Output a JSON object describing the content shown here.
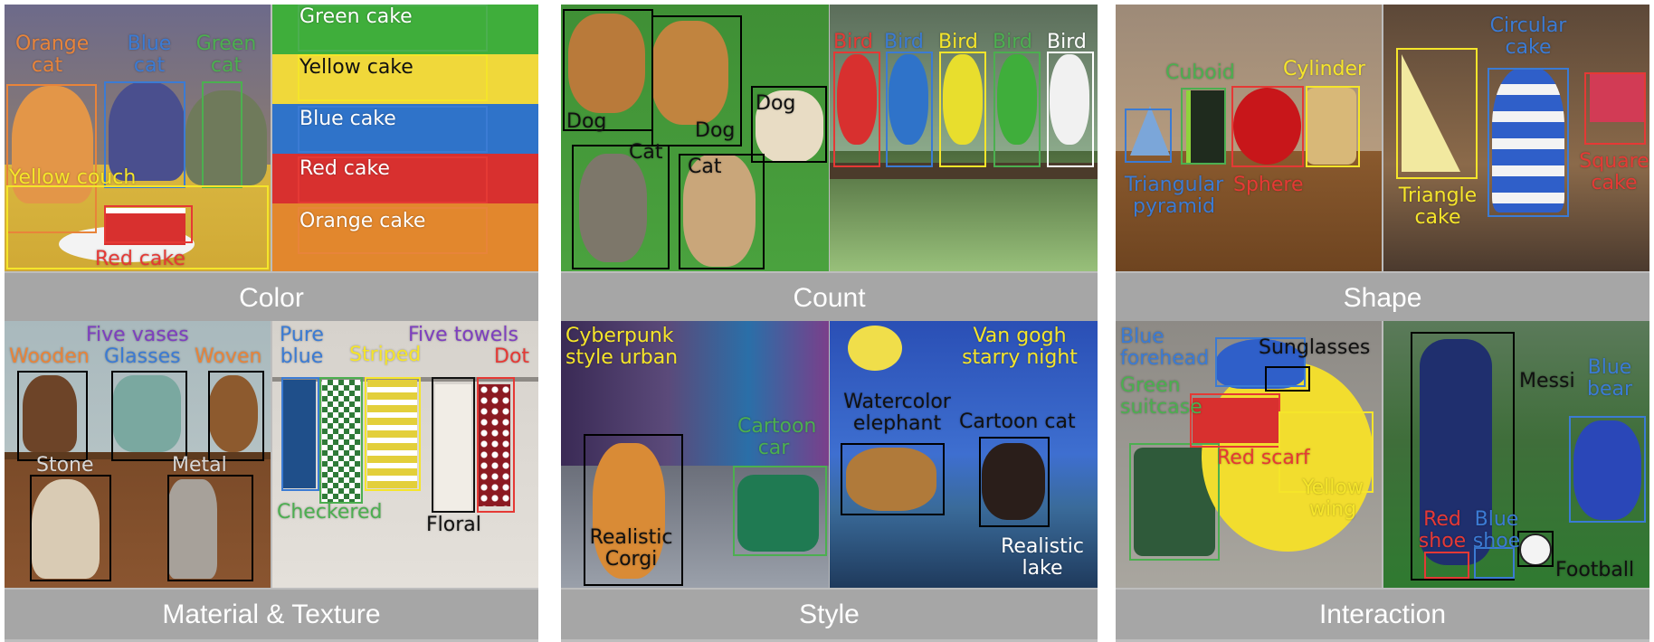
{
  "panels": {
    "color": {
      "caption": "Color",
      "left": {
        "orange_cat": "Orange cat",
        "blue_cat": "Blue cat",
        "green_cat": "Green cat",
        "yellow_couch": "Yellow couch",
        "red_cake": "Red cake"
      },
      "right": {
        "green_cake": "Green cake",
        "yellow_cake": "Yellow cake",
        "blue_cake": "Blue cake",
        "red_cake": "Red cake",
        "orange_cake": "Orange cake"
      }
    },
    "count": {
      "caption": "Count",
      "left": {
        "dog1": "Dog",
        "dog2": "Dog",
        "dog3": "Dog",
        "cat1": "Cat",
        "cat2": "Cat"
      },
      "right": {
        "bird1": "Bird",
        "bird2": "Bird",
        "bird3": "Bird",
        "bird4": "Bird",
        "bird5": "Bird"
      }
    },
    "shape": {
      "caption": "Shape",
      "left": {
        "cuboid": "Cuboid",
        "cylinder": "Cylinder",
        "triangular_pyramid": "Triangular pyramid",
        "sphere": "Sphere"
      },
      "right": {
        "circular_cake": "Circular cake",
        "triangle_cake": "Triangle cake",
        "square_cake": "Square cake"
      }
    },
    "material": {
      "caption": "Material & Texture",
      "left": {
        "five_vases": "Five vases",
        "wooden": "Wooden",
        "glasses": "Glasses",
        "woven": "Woven",
        "stone": "Stone",
        "metal": "Metal"
      },
      "right": {
        "pure_blue": "Pure blue",
        "striped": "Striped",
        "five_towels": "Five towels",
        "dot": "Dot",
        "checkered": "Checkered",
        "floral": "Floral"
      }
    },
    "style": {
      "caption": "Style",
      "left": {
        "cyberpunk": "Cyberpunk style urban",
        "cartoon_car": "Cartoon car",
        "realistic_corgi": "Realistic Corgi"
      },
      "right": {
        "van_gogh": "Van gogh starry night",
        "watercolor_elephant": "Watercolor elephant",
        "cartoon_cat": "Cartoon cat",
        "realistic_lake": "Realistic lake"
      }
    },
    "interaction": {
      "caption": "Interaction",
      "left": {
        "blue_forehead": "Blue forehead",
        "sunglasses": "Sunglasses",
        "green_suitcase": "Green suitcase",
        "red_scarf": "Red scarf",
        "yellow_wing": "Yellow wing"
      },
      "right": {
        "messi": "Messi",
        "blue_bear": "Blue bear",
        "red_shoe": "Red shoe",
        "blue_shoe": "Blue shoe",
        "football": "Football"
      }
    }
  },
  "colors": {
    "caption_bg": "#a6a6a6",
    "orange": "#e8843a",
    "blue": "#3b7bd4",
    "green": "#4caf50",
    "yellow": "#f5e52a",
    "red": "#e53935",
    "purple": "#7e3fbf",
    "black": "#111111",
    "white": "#ffffff"
  }
}
